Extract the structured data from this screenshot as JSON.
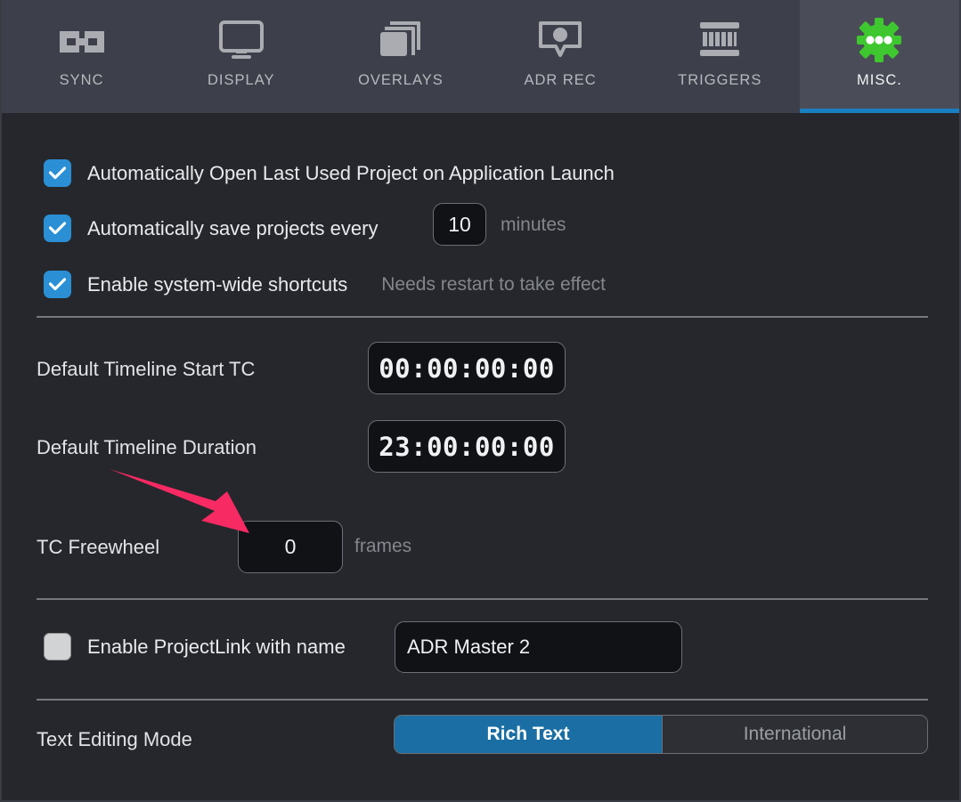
{
  "toolbar": {
    "tabs": [
      {
        "label": "SYNC",
        "icon": "link-chain-icon",
        "active": false
      },
      {
        "label": "DISPLAY",
        "icon": "monitor-icon",
        "active": false
      },
      {
        "label": "OVERLAYS",
        "icon": "layers-icon",
        "active": false
      },
      {
        "label": "ADR REC",
        "icon": "speech-dot-icon",
        "active": false
      },
      {
        "label": "TRIGGERS",
        "icon": "midi-icon",
        "active": false
      },
      {
        "label": "MISC.",
        "icon": "gear-dots-icon",
        "active": true
      }
    ]
  },
  "settings": {
    "auto_open": {
      "label": "Automatically Open Last Used Project on Application Launch",
      "checked": true
    },
    "auto_save": {
      "label": "Automatically save projects every",
      "value": "10",
      "unit": "minutes",
      "checked": true
    },
    "system_shortcuts": {
      "label": "Enable system-wide shortcuts",
      "note": "Needs restart to take effect",
      "checked": true
    },
    "default_start_tc": {
      "label": "Default Timeline Start TC",
      "value": "00:00:00:00"
    },
    "default_duration": {
      "label": "Default Timeline Duration",
      "value": "23:00:00:00"
    },
    "tc_freewheel": {
      "label": "TC Freewheel",
      "value": "0",
      "unit": "frames"
    },
    "project_link": {
      "label": "Enable ProjectLink with name",
      "name_value": "ADR Master 2",
      "checked": false
    },
    "text_editing_mode": {
      "label": "Text Editing Mode",
      "options": [
        "Rich Text",
        "International"
      ],
      "selected": "Rich Text"
    }
  },
  "annotation": {
    "arrow_name": "pointer-arrow",
    "color": "#f72a63",
    "points_at": "tc-freewheel-input"
  },
  "colors": {
    "toolbar_bg": "#3d404a",
    "active_tab_bg": "#4a4d57",
    "accent_blue": "#1a7fc1",
    "checkbox_blue": "#2a8fd4",
    "gear_green": "#3ec72f",
    "body_bg": "#26272c",
    "field_bg": "#111216"
  }
}
